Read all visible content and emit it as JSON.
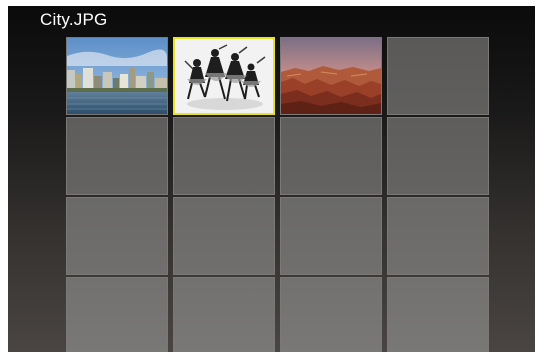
{
  "viewer": {
    "filename": "City.JPG"
  },
  "thumbnails": [
    {
      "name": "city-harbor-thumbnail",
      "icon": "city-skyline-photo",
      "selected": false
    },
    {
      "name": "dancers-thumbnail",
      "icon": "bw-dancers-photo",
      "selected": true
    },
    {
      "name": "canyon-thumbnail",
      "icon": "canyon-sunset-photo",
      "selected": false
    }
  ],
  "colors": {
    "selection": "#e9e12a",
    "empty_slot": "#5f5e5d",
    "title_text": "#ffffff"
  }
}
